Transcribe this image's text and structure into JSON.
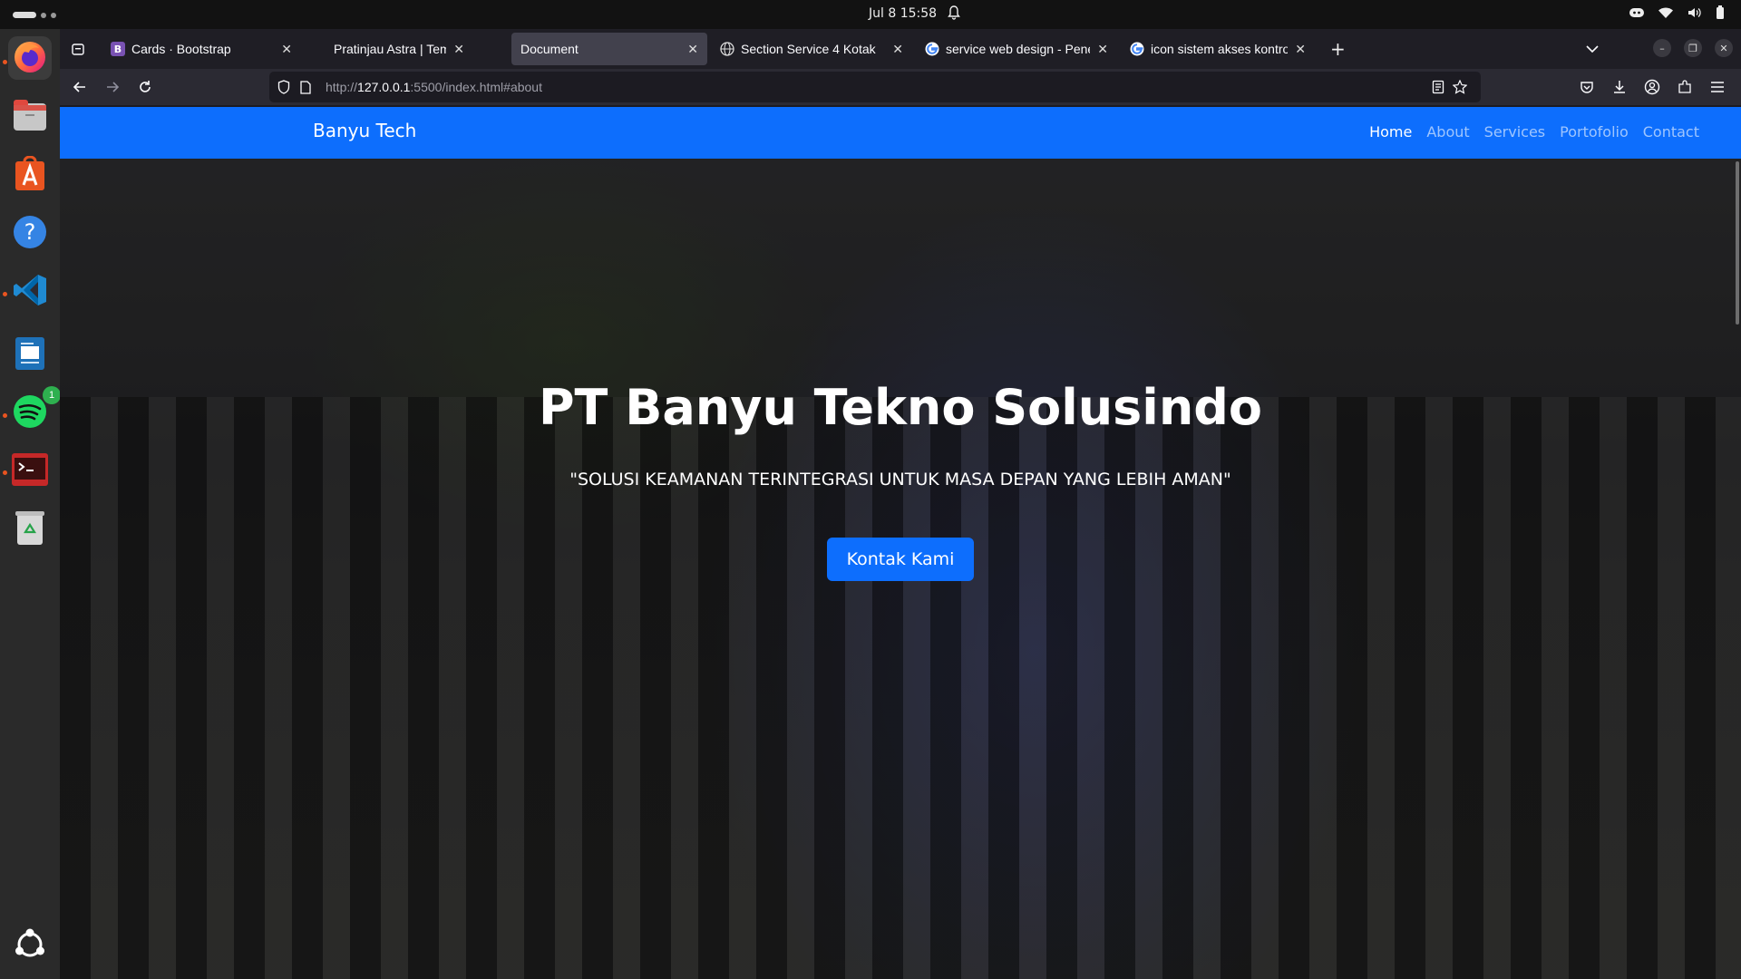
{
  "system": {
    "clock": "Jul 8  15:58"
  },
  "dock": {
    "items": [
      "Firefox",
      "Files",
      "App Center",
      "Help",
      "Visual Studio Code",
      "LibreOffice Writer",
      "Spotify",
      "Terminal",
      "Trash",
      "Show Apps"
    ],
    "spotify_badge": "1"
  },
  "browser": {
    "tabs": [
      {
        "label": "Cards · Bootstrap",
        "icon": "bootstrap-icon"
      },
      {
        "label": "Pratinjau Astra | Tema We",
        "icon": "none"
      },
      {
        "label": "Document",
        "icon": "none"
      },
      {
        "label": "Section Service 4 Kotak",
        "icon": "globe-icon"
      },
      {
        "label": "service web design - Pene",
        "icon": "google-icon"
      },
      {
        "label": "icon sistem akses kontrol",
        "icon": "google-icon"
      }
    ],
    "active_tab": "Document",
    "url_prefix": "http://",
    "url_host": "127.0.0.1",
    "url_rest": ":5500/index.html#about"
  },
  "site": {
    "brand": "Banyu Tech",
    "nav": [
      "Home",
      "About",
      "Services",
      "Portofolio",
      "Contact"
    ],
    "active_nav": "Home",
    "hero_title": "PT Banyu Tekno Solusindo",
    "hero_tagline": "\"SOLUSI KEAMANAN TERINTEGRASI UNTUK MASA DEPAN YANG LEBIH AMAN\"",
    "cta_label": "Kontak Kami",
    "accent": "#0d6efd"
  }
}
